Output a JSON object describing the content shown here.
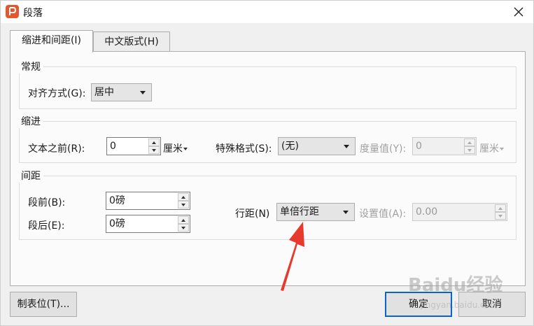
{
  "window": {
    "title": "段落"
  },
  "tabs": [
    {
      "label": "缩进和间距(I)",
      "active": true
    },
    {
      "label": "中文版式(H)",
      "active": false
    }
  ],
  "general": {
    "group_title": "常规",
    "alignment_label": "对齐方式(G):",
    "alignment_value": "居中"
  },
  "indent": {
    "group_title": "缩进",
    "before_text_label": "文本之前(R):",
    "before_text_value": "0",
    "before_text_unit": "厘米",
    "special_label": "特殊格式(S):",
    "special_value": "(无)",
    "measure_label": "度量值(Y):",
    "measure_value": "0",
    "measure_unit": "厘米"
  },
  "spacing": {
    "group_title": "间距",
    "before_label": "段前(B):",
    "before_value": "0磅",
    "after_label": "段后(E):",
    "after_value": "0磅",
    "line_spacing_label": "行距(N)",
    "line_spacing_value": "单倍行距",
    "set_value_label": "设置值(A):",
    "set_value_value": "0.00"
  },
  "buttons": {
    "tabs_label": "制表位(T)...",
    "ok_label": "确定",
    "cancel_label": "取消"
  },
  "overlay": {
    "watermark": "Baidu经验",
    "watermark_sub": "jingyan.baidu.com",
    "arrow_color": "#e8392f"
  },
  "colors": {
    "app_icon": "#e4572e",
    "focus_border": "#0a64c8"
  }
}
